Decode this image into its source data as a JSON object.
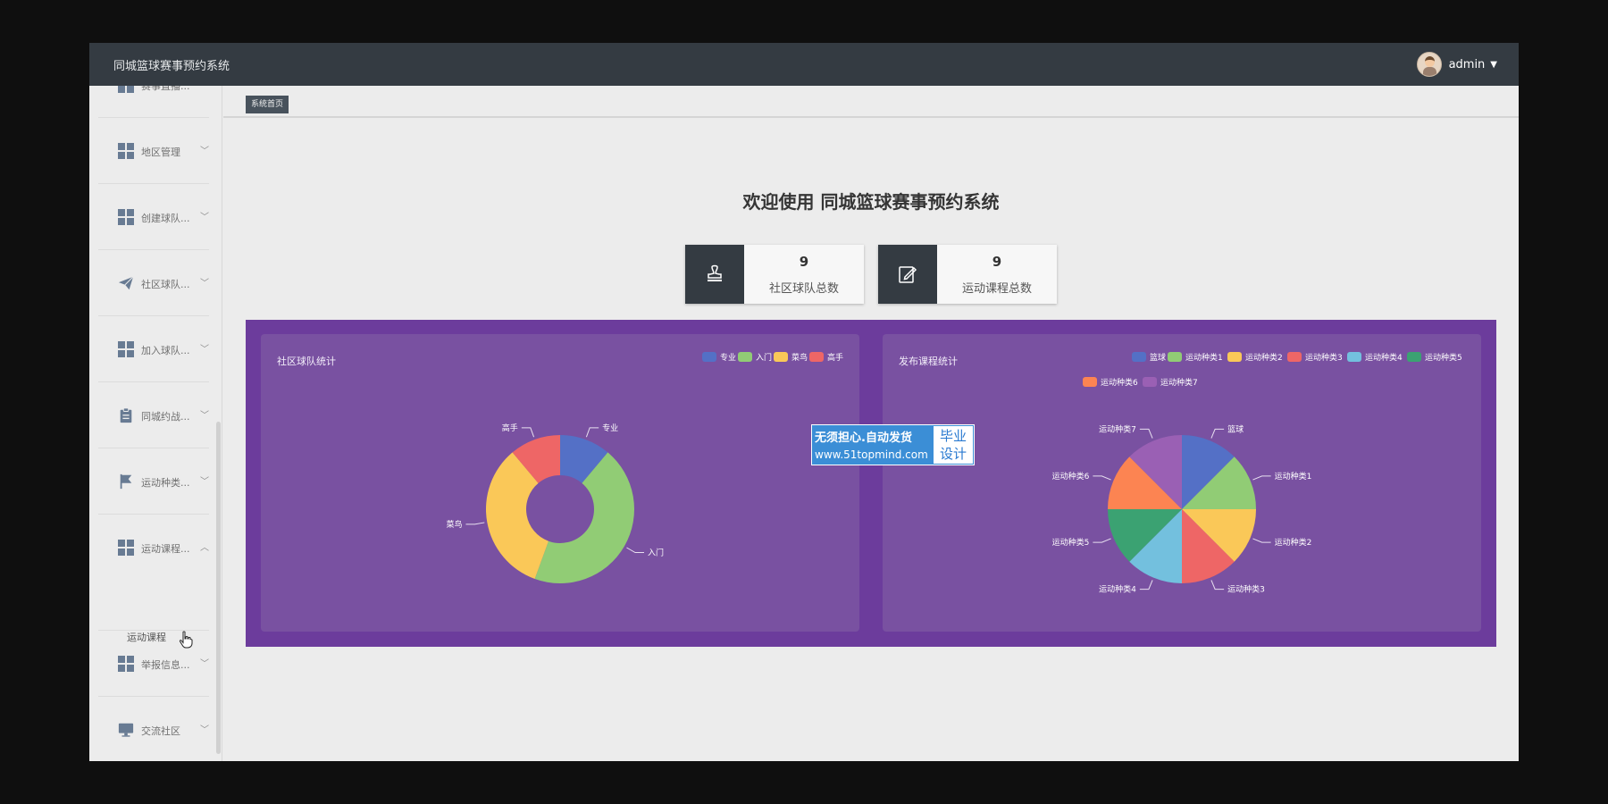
{
  "header": {
    "title": "同城篮球赛事预约系统",
    "user": "admin"
  },
  "sidebar": {
    "items": [
      {
        "label": "赛事直播...",
        "icon": "grid-icon"
      },
      {
        "label": "地区管理",
        "icon": "grid-icon"
      },
      {
        "label": "创建球队...",
        "icon": "grid-icon"
      },
      {
        "label": "社区球队...",
        "icon": "paper-plane-icon"
      },
      {
        "label": "加入球队...",
        "icon": "grid-icon"
      },
      {
        "label": "同城约战...",
        "icon": "clipboard-icon"
      },
      {
        "label": "运动种类...",
        "icon": "flag-icon"
      },
      {
        "label": "运动课程...",
        "icon": "grid-icon",
        "expanded": true
      },
      {
        "label": "举报信息...",
        "icon": "grid-icon"
      },
      {
        "label": "交流社区",
        "icon": "monitor-icon"
      }
    ],
    "submenu": {
      "label": "运动课程"
    }
  },
  "breadcrumb": {
    "label": "系统首页"
  },
  "welcome": "欢迎使用 同城篮球赛事预约系统",
  "stats": [
    {
      "value": "9",
      "label": "社区球队总数",
      "icon": "stamp-icon"
    },
    {
      "value": "9",
      "label": "运动课程总数",
      "icon": "edit-icon"
    }
  ],
  "watermark": {
    "line1": "无须担心.自动发货",
    "line2": "www.51topmind.com",
    "right_top": "毕业",
    "right_bottom": "设计"
  },
  "chart_data": [
    {
      "type": "pie",
      "variant": "donut",
      "title": "社区球队统计",
      "legend_position": "top-right",
      "categories": [
        "专业",
        "入门",
        "菜鸟",
        "高手"
      ],
      "values": [
        1,
        4,
        3,
        1
      ],
      "colors": [
        "#5470c6",
        "#91cc75",
        "#fac858",
        "#ee6666"
      ]
    },
    {
      "type": "pie",
      "title": "发布课程统计",
      "legend_position": "top-right",
      "categories": [
        "篮球",
        "运动种类1",
        "运动种类2",
        "运动种类3",
        "运动种类4",
        "运动种类5",
        "运动种类6",
        "运动种类7"
      ],
      "values": [
        1,
        1,
        1,
        1,
        1,
        1,
        1,
        1
      ],
      "colors": [
        "#5470c6",
        "#91cc75",
        "#fac858",
        "#ee6666",
        "#73c0de",
        "#3ba272",
        "#fc8452",
        "#9a60b4"
      ]
    }
  ]
}
